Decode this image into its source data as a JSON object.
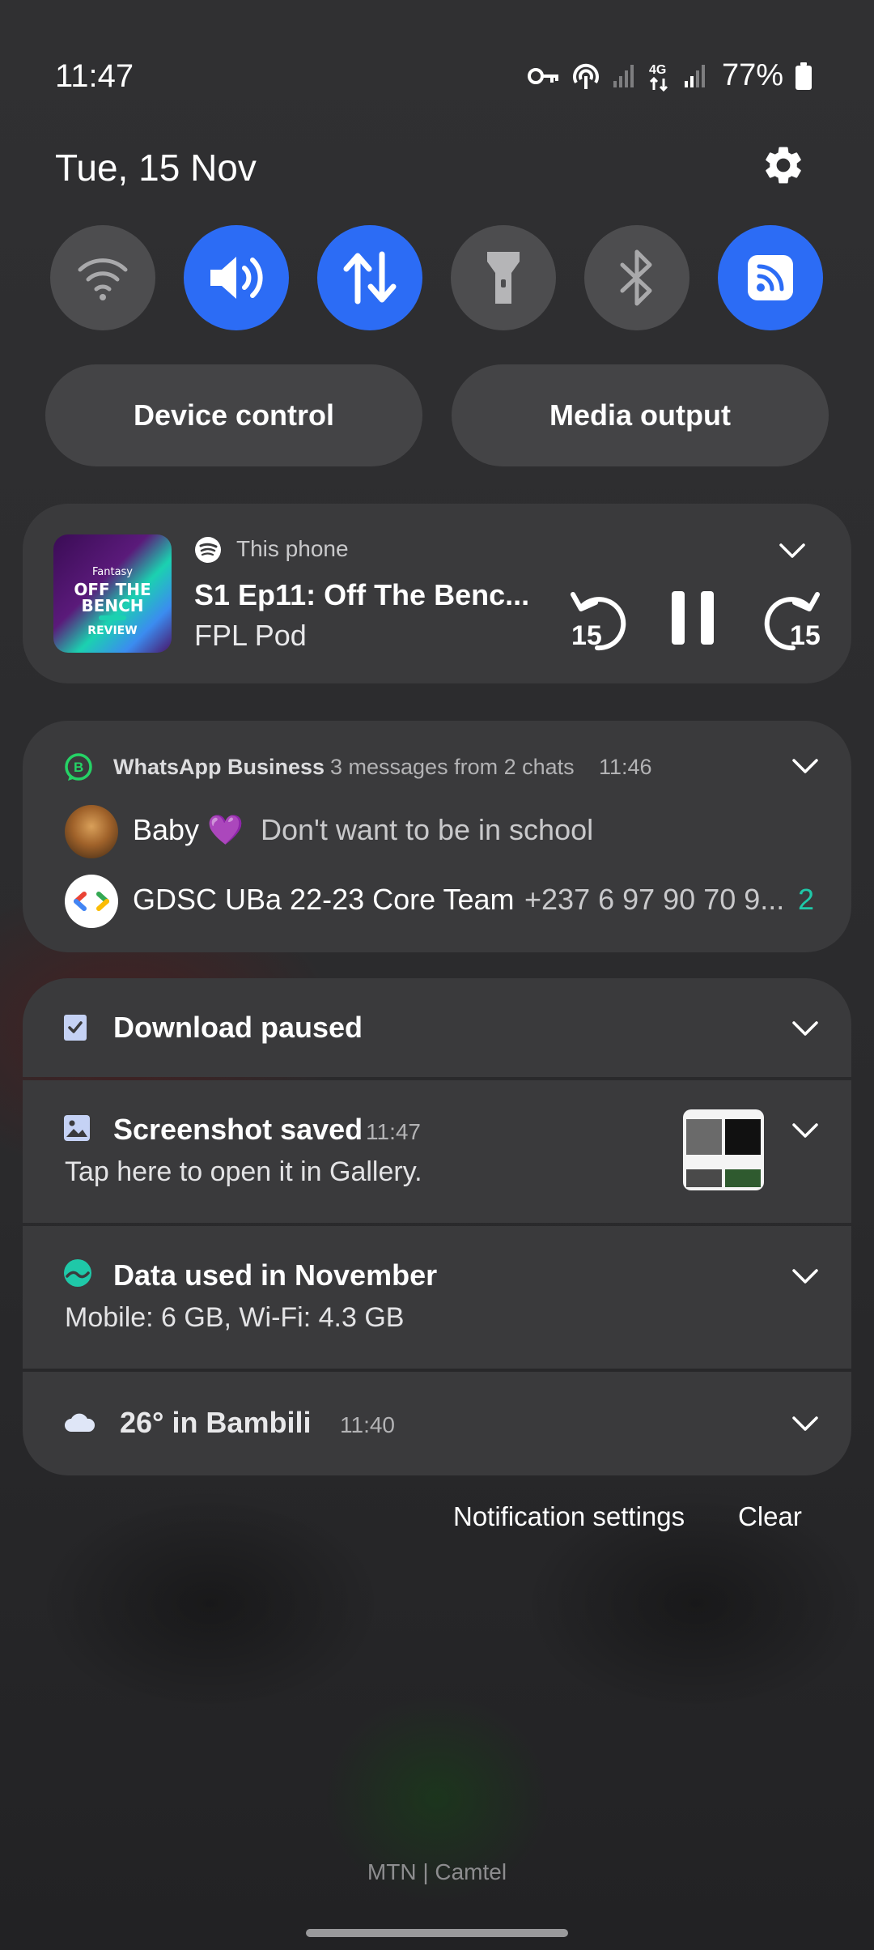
{
  "status_bar": {
    "time": "11:47",
    "battery_percent": "77%",
    "network_type": "4G"
  },
  "header": {
    "date": "Tue, 15 Nov"
  },
  "quick_toggles": [
    {
      "name": "wifi-icon",
      "state": "off"
    },
    {
      "name": "sound-icon",
      "state": "on"
    },
    {
      "name": "mobile-data-icon",
      "state": "on"
    },
    {
      "name": "flashlight-icon",
      "state": "off"
    },
    {
      "name": "bluetooth-icon",
      "state": "off"
    },
    {
      "name": "nfc-icon",
      "state": "on"
    }
  ],
  "pills": {
    "device_control": "Device control",
    "media_output": "Media output"
  },
  "media": {
    "source": "This phone",
    "title": "S1 Ep11: Off The Benc...",
    "artist": "FPL Pod",
    "skip_back": "15",
    "skip_forward": "15",
    "art_brand": "Fantasy",
    "art_line1": "OFF THE",
    "art_line2": "BENCH",
    "art_line3": "REVIEW"
  },
  "whatsapp": {
    "app": "WhatsApp Business",
    "summary": "3 messages from 2 chats",
    "time": "11:46",
    "messages": [
      {
        "sender": "Baby 💜",
        "text": "Don't want to be in school",
        "count": ""
      },
      {
        "sender": "GDSC UBa 22-23 Core Team",
        "text": "+237 6 97 90 70 9...",
        "count": "2"
      }
    ]
  },
  "notifications": {
    "download": {
      "title": "Download paused"
    },
    "screenshot": {
      "title": "Screenshot saved",
      "time": "11:47",
      "body": "Tap here to open it in Gallery."
    },
    "data": {
      "title": "Data used in November",
      "body": "Mobile: 6 GB, Wi-Fi: 4.3 GB"
    },
    "weather": {
      "title": "26° in Bambili",
      "time": "11:40"
    }
  },
  "footer": {
    "notification_settings": "Notification settings",
    "clear": "Clear",
    "carrier": "MTN | Camtel"
  },
  "colors": {
    "accent_blue": "#2c6cf5",
    "whatsapp_green": "#25d366",
    "count_teal": "#1fc8a8"
  }
}
